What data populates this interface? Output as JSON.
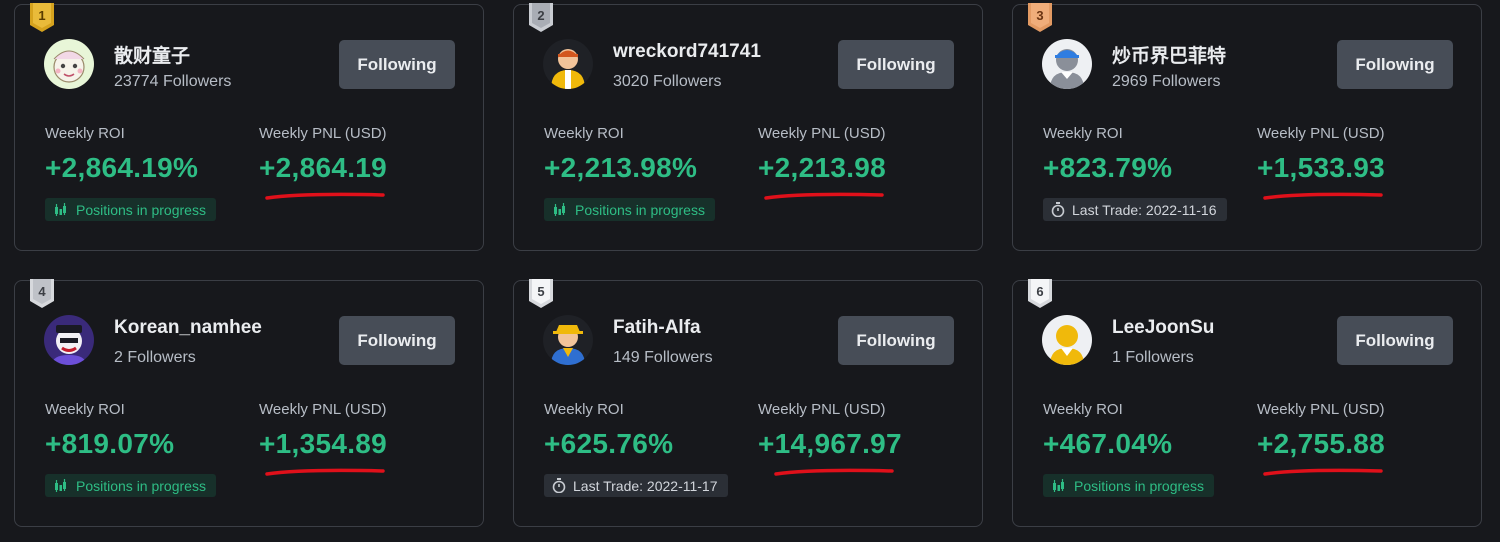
{
  "labels": {
    "follow": "Following",
    "roi": "Weekly ROI",
    "pnl": "Weekly PNL (USD)"
  },
  "colors": {
    "background": "#17181c",
    "card_border": "#3b3e45",
    "positive": "#2ebd85",
    "button": "#474d57",
    "annotation": "#e0101a",
    "rank_gold": "#d6a31e",
    "rank_silver": "#c9ccd2",
    "rank_bronze": "#e39a63",
    "rank_plain": "#d7d9dd"
  },
  "traders": [
    {
      "rank": "1",
      "name": "散财童子",
      "followers": "23774 Followers",
      "roi": "+2,864.19%",
      "pnl": "+2,864.19",
      "status": "Positions in progress",
      "status_type": "progress",
      "avatar": "cartoon-avatar-icon"
    },
    {
      "rank": "2",
      "name": "wreckord741741",
      "followers": "3020 Followers",
      "roi": "+2,213.98%",
      "pnl": "+2,213.98",
      "status": "Positions in progress",
      "status_type": "progress",
      "avatar": "default-avatar-icon"
    },
    {
      "rank": "3",
      "name": "炒币界巴菲特",
      "followers": "2969 Followers",
      "roi": "+823.79%",
      "pnl": "+1,533.93",
      "status": "Last Trade: 2022-11-16",
      "status_type": "trade",
      "avatar": "default-avatar-icon"
    },
    {
      "rank": "4",
      "name": "Korean_namhee",
      "followers": "2 Followers",
      "roi": "+819.07%",
      "pnl": "+1,354.89",
      "status": "Positions in progress",
      "status_type": "progress",
      "avatar": "custom-avatar-icon"
    },
    {
      "rank": "5",
      "name": "Fatih-Alfa",
      "followers": "149 Followers",
      "roi": "+625.76%",
      "pnl": "+14,967.97",
      "status": "Last Trade: 2022-11-17",
      "status_type": "trade",
      "avatar": "default-avatar-icon"
    },
    {
      "rank": "6",
      "name": "LeeJoonSu",
      "followers": "1 Followers",
      "roi": "+467.04%",
      "pnl": "+2,755.88",
      "status": "Positions in progress",
      "status_type": "progress",
      "avatar": "default-avatar-icon"
    }
  ]
}
